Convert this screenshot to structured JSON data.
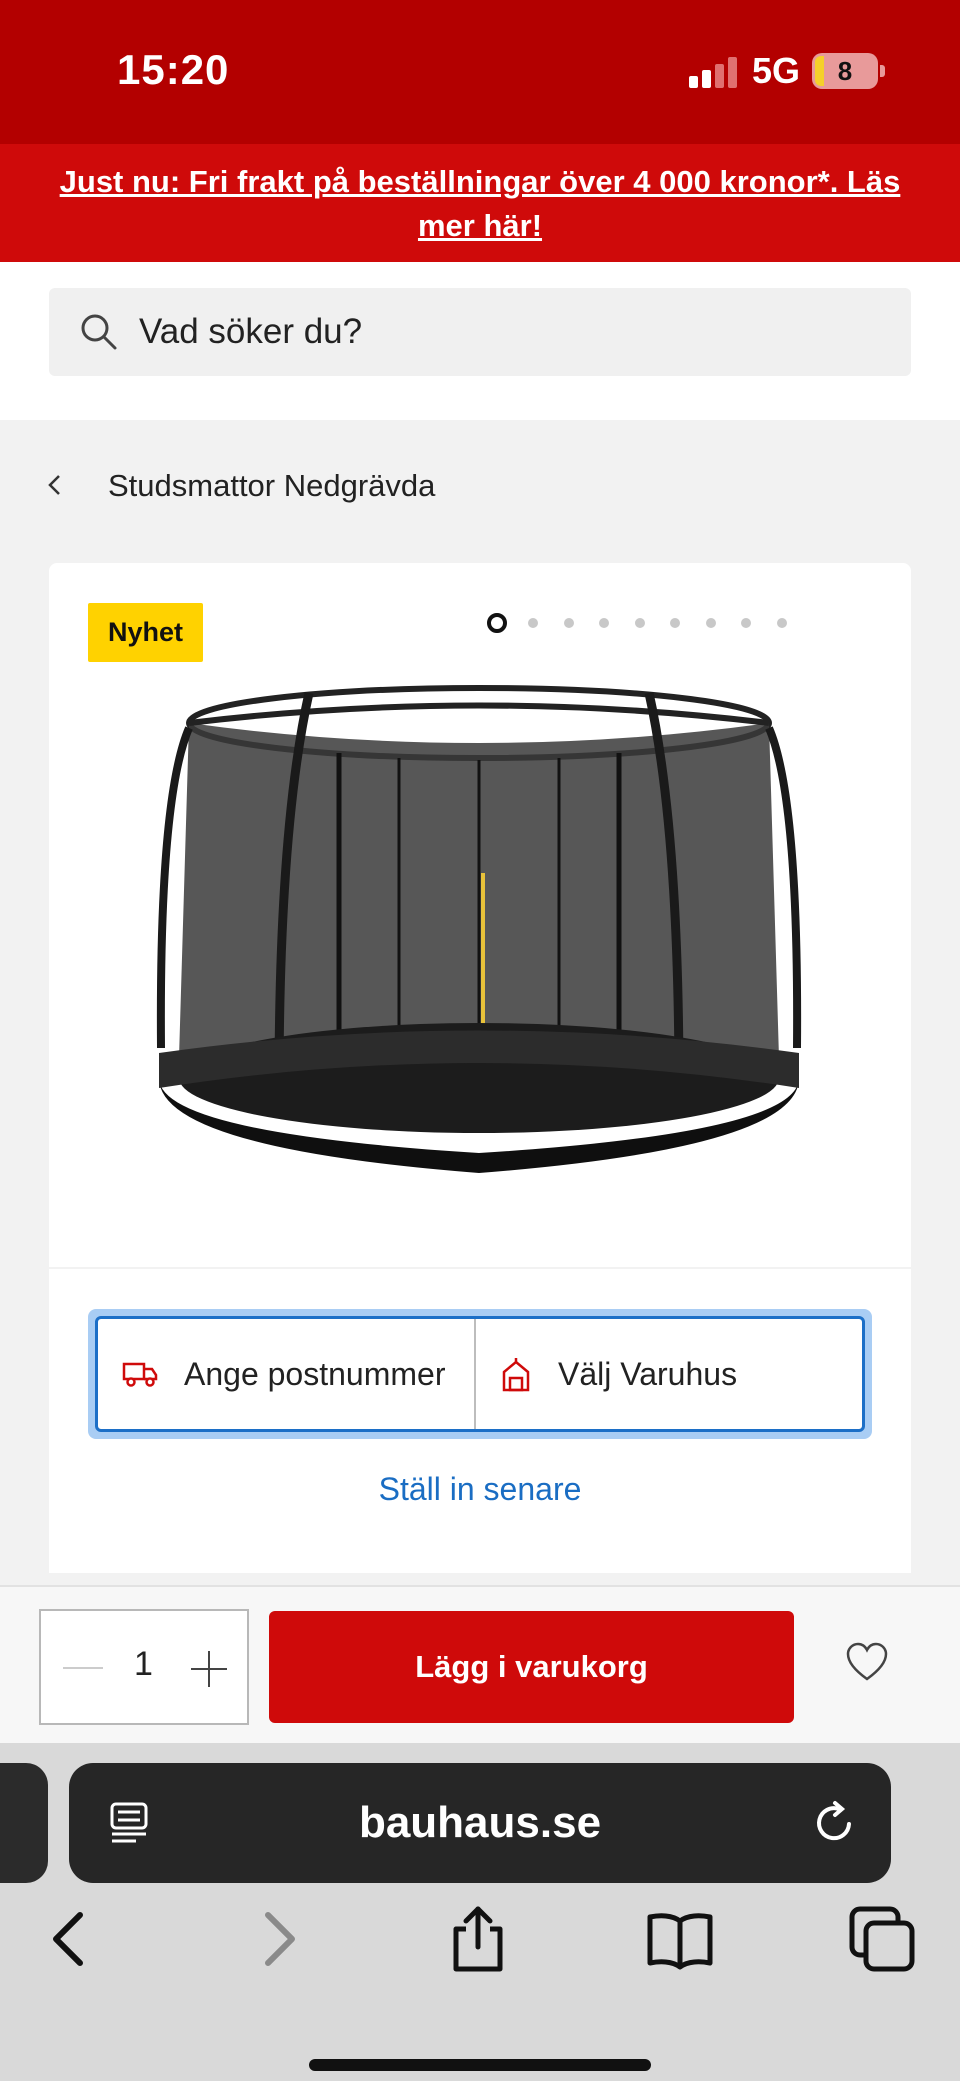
{
  "status_bar": {
    "time": "15:20",
    "network": "5G",
    "battery_level": "8"
  },
  "promo": {
    "text": "Just nu: Fri frakt på beställningar över 4 000 kronor*. Läs mer här!"
  },
  "search": {
    "placeholder": "Vad söker du?",
    "icon": "search-icon"
  },
  "breadcrumb": {
    "label": "Studsmattor Nedgrävda",
    "icon": "chevron-left-icon"
  },
  "product": {
    "badge": "Nyhet",
    "image_alt": "trampoline with safety net",
    "carousel": {
      "total": 9,
      "active": 1
    }
  },
  "delivery_picker": {
    "postcode_label": "Ange postnummer",
    "postcode_icon": "truck-icon",
    "store_label": "Välj Varuhus",
    "store_icon": "store-icon",
    "later_label": "Ställ in senare"
  },
  "cart": {
    "quantity": "1",
    "add_label": "Lägg i varukorg",
    "wishlist_icon": "heart-icon"
  },
  "browser": {
    "url": "bauhaus.se"
  },
  "colors": {
    "brand_red": "#cf0a0a",
    "status_red": "#b30000",
    "badge_yellow": "#ffd200",
    "link_blue": "#1a6dc3"
  }
}
